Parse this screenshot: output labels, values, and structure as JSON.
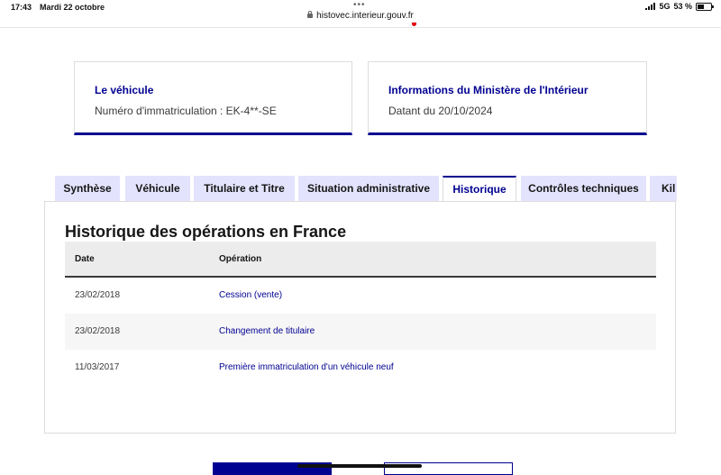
{
  "status_bar": {
    "time": "17:43",
    "date": "Mardi 22 octobre",
    "network": "5G",
    "battery": "53 %",
    "battery_level": 0.53
  },
  "browser": {
    "url": "histovec.interieur.gouv.fr"
  },
  "cards": [
    {
      "title": "Le véhicule",
      "text": "Numéro d'immatriculation : EK-4**-SE"
    },
    {
      "title": "Informations du Ministère de l'Intérieur",
      "text": "Datant du 20/10/2024"
    }
  ],
  "tabs": [
    {
      "label": "Synthèse",
      "active": false
    },
    {
      "label": "Véhicule",
      "active": false
    },
    {
      "label": "Titulaire et Titre",
      "active": false
    },
    {
      "label": "Situation administrative",
      "active": false
    },
    {
      "label": "Historique",
      "active": true
    },
    {
      "label": "Contrôles techniques",
      "active": false
    },
    {
      "label": "Kil",
      "active": false
    }
  ],
  "history": {
    "title": "Historique des opérations en France",
    "columns": {
      "date": "Date",
      "operation": "Opération"
    },
    "rows": [
      {
        "date": "23/02/2018",
        "operation": "Cession (vente)"
      },
      {
        "date": "23/02/2018",
        "operation": "Changement de titulaire"
      },
      {
        "date": "11/03/2017",
        "operation": "Première immatriculation d'un véhicule neuf"
      }
    ]
  },
  "colors": {
    "primary": "#000091",
    "tab_bg": "#e3e3fd",
    "table_header_bg": "#ececec",
    "row_alt_bg": "#f6f6f6"
  }
}
